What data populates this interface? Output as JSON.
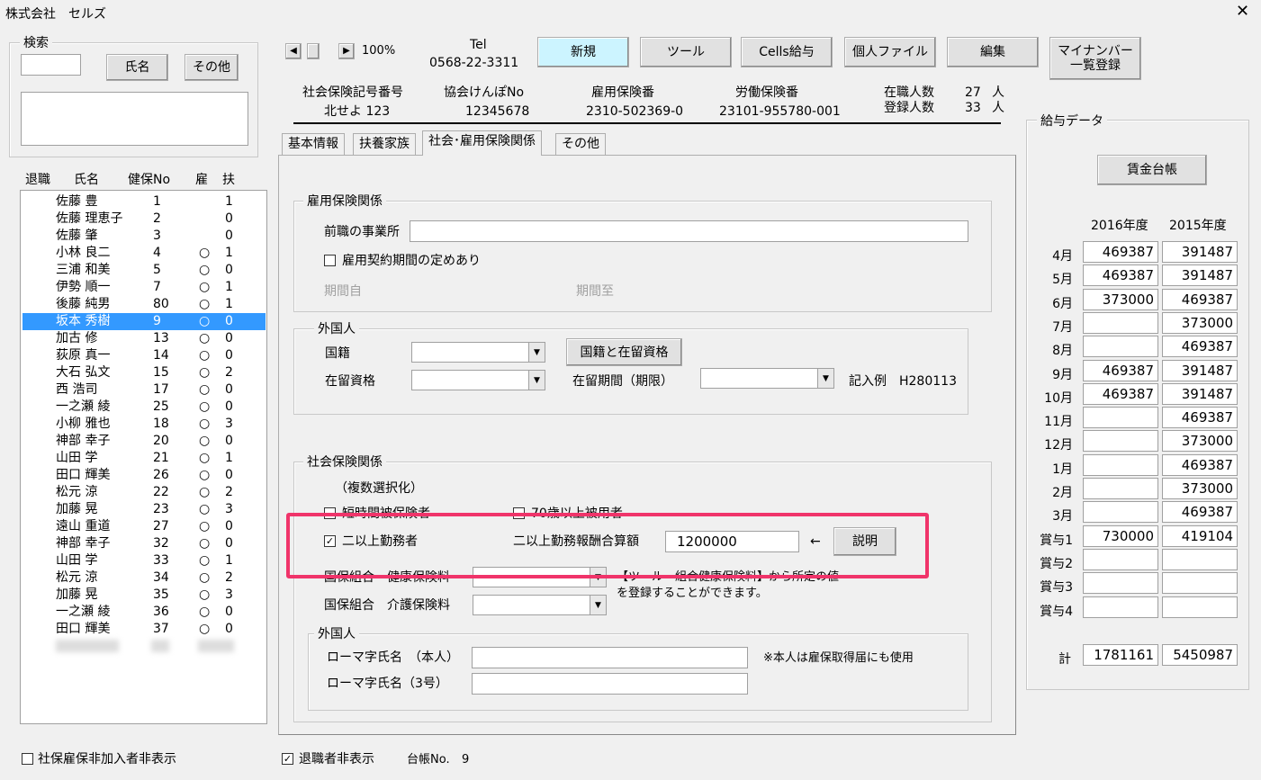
{
  "window": {
    "title": "株式会社　セルズ",
    "close_icon": "close-icon"
  },
  "search": {
    "legend": "検索",
    "name_button": "氏名",
    "other_button": "その他",
    "input_value": ""
  },
  "employee_list": {
    "headers": {
      "retired": "退職",
      "name": "氏名",
      "kenpo": "健保No",
      "koyo": "雇",
      "fuyo": "扶"
    },
    "rows": [
      {
        "name": "佐藤 豊",
        "no": "1",
        "koyo": "",
        "fuyo": "1"
      },
      {
        "name": "佐藤 理恵子",
        "no": "2",
        "koyo": "",
        "fuyo": "0"
      },
      {
        "name": "佐藤 肇",
        "no": "3",
        "koyo": "",
        "fuyo": "0"
      },
      {
        "name": "小林 良二",
        "no": "4",
        "koyo": "○",
        "fuyo": "1"
      },
      {
        "name": "三浦 和美",
        "no": "5",
        "koyo": "○",
        "fuyo": "0"
      },
      {
        "name": "伊勢 順一",
        "no": "7",
        "koyo": "○",
        "fuyo": "1"
      },
      {
        "name": "後藤 純男",
        "no": "80",
        "koyo": "○",
        "fuyo": "1"
      },
      {
        "name": "坂本 秀樹",
        "no": "9",
        "koyo": "○",
        "fuyo": "0"
      },
      {
        "name": "加古 修",
        "no": "13",
        "koyo": "○",
        "fuyo": "0"
      },
      {
        "name": "荻原 真一",
        "no": "14",
        "koyo": "○",
        "fuyo": "0"
      },
      {
        "name": "大石 弘文",
        "no": "15",
        "koyo": "○",
        "fuyo": "2"
      },
      {
        "name": "西 浩司",
        "no": "17",
        "koyo": "○",
        "fuyo": "0"
      },
      {
        "name": "一之瀬 綾",
        "no": "25",
        "koyo": "○",
        "fuyo": "0"
      },
      {
        "name": "小柳 雅也",
        "no": "18",
        "koyo": "○",
        "fuyo": "3"
      },
      {
        "name": "神部 幸子",
        "no": "20",
        "koyo": "○",
        "fuyo": "0"
      },
      {
        "name": "山田 学",
        "no": "21",
        "koyo": "○",
        "fuyo": "1"
      },
      {
        "name": "田口 輝美",
        "no": "26",
        "koyo": "○",
        "fuyo": "0"
      },
      {
        "name": "松元 涼",
        "no": "22",
        "koyo": "○",
        "fuyo": "2"
      },
      {
        "name": "加藤 晃",
        "no": "23",
        "koyo": "○",
        "fuyo": "3"
      },
      {
        "name": "遠山 重道",
        "no": "27",
        "koyo": "○",
        "fuyo": "0"
      },
      {
        "name": "神部 幸子",
        "no": "32",
        "koyo": "○",
        "fuyo": "0"
      },
      {
        "name": "山田 学",
        "no": "33",
        "koyo": "○",
        "fuyo": "1"
      },
      {
        "name": "松元 涼",
        "no": "34",
        "koyo": "○",
        "fuyo": "2"
      },
      {
        "name": "加藤 晃",
        "no": "35",
        "koyo": "○",
        "fuyo": "3"
      },
      {
        "name": "一之瀬 綾",
        "no": "36",
        "koyo": "○",
        "fuyo": "0"
      },
      {
        "name": "田口 輝美",
        "no": "37",
        "koyo": "○",
        "fuyo": "0"
      }
    ],
    "selected_index": 7
  },
  "bottom": {
    "shaho_hide_label": "社保雇保非加入者非表示",
    "shaho_hide_checked": false,
    "retired_hide_label": "退職者非表示",
    "retired_hide_checked": true,
    "ledger_label": "台帳No.",
    "ledger_no": "9"
  },
  "toolbar": {
    "zoom": "100%",
    "tel_label": "Tel",
    "tel_value": "0568-22-3311",
    "new_button": "新規",
    "tool_button": "ツール",
    "cells_button": "Cells給与",
    "personal_file_button": "個人ファイル",
    "edit_button": "編集",
    "mynumber_button_line1": "マイナンバー",
    "mynumber_button_line2": "一覧登録"
  },
  "company_info": {
    "shaho_code_label": "社会保険記号番号",
    "shaho_code_value": "北せよ 123",
    "kyokai_label": "協会けんぽNo",
    "kyokai_value": "12345678",
    "koyo_label": "雇用保険番",
    "koyo_value": "2310-502369-0",
    "rodo_label": "労働保険番",
    "rodo_value": "23101-955780-001",
    "current_count_label": "在職人数",
    "current_count": "27",
    "registered_count_label": "登録人数",
    "registered_count": "33",
    "person_unit": "人"
  },
  "tabs": [
    "基本情報",
    "扶養家族",
    "社会･雇用保険関係",
    "その他"
  ],
  "active_tab": 2,
  "employment_insurance": {
    "legend": "雇用保険関係",
    "prev_employer_label": "前職の事業所",
    "prev_employer_value": "",
    "contract_period_label": "雇用契約期間の定めあり",
    "contract_period_checked": false,
    "period_from_label": "期間自",
    "period_to_label": "期間至"
  },
  "foreigner1": {
    "legend": "外国人",
    "nationality_label": "国籍",
    "status_label": "在留資格",
    "nationality_status_button": "国籍と在留資格",
    "period_label": "在留期間（期限）",
    "example_label": "記入例　H280113"
  },
  "social_insurance": {
    "legend": "社会保険関係",
    "multi_select_note": "（複数選択化）",
    "short_time_label": "短時間被保険者",
    "over70_label": "70歳以上被用者",
    "dual_work_label": "二以上勤務者",
    "dual_work_checked": true,
    "dual_amount_label": "二以上勤務報酬合算額",
    "dual_amount_value": "1200000",
    "arrow": "←",
    "explain_button": "説明",
    "kokuho_health_label": "国保組合　健康保険料",
    "kokuho_care_label": "国保組合　介護保険料",
    "note_line1": "【ツール　組合健康保険料】から所定の値",
    "note_line2": "を登録することができます。"
  },
  "foreigner2": {
    "legend": "外国人",
    "romaji_label": "ローマ字氏名　（本人）",
    "romaji_value": "",
    "romaji_note": "※本人は雇保取得届にも使用",
    "romaji3_label": "ローマ字氏名（3号）",
    "romaji3_value": ""
  },
  "wage_data": {
    "legend": "給与データ",
    "ledger_button": "賃金台帳",
    "year1": "2016年度",
    "year2": "2015年度",
    "rows": [
      {
        "month": "4月",
        "y1": "469387",
        "y2": "391487"
      },
      {
        "month": "5月",
        "y1": "469387",
        "y2": "391487"
      },
      {
        "month": "6月",
        "y1": "373000",
        "y2": "469387"
      },
      {
        "month": "7月",
        "y1": "",
        "y2": "373000"
      },
      {
        "month": "8月",
        "y1": "",
        "y2": "469387"
      },
      {
        "month": "9月",
        "y1": "469387",
        "y2": "391487"
      },
      {
        "month": "10月",
        "y1": "469387",
        "y2": "391487"
      },
      {
        "month": "11月",
        "y1": "",
        "y2": "469387"
      },
      {
        "month": "12月",
        "y1": "",
        "y2": "373000"
      },
      {
        "month": "1月",
        "y1": "",
        "y2": "469387"
      },
      {
        "month": "2月",
        "y1": "",
        "y2": "373000"
      },
      {
        "month": "3月",
        "y1": "",
        "y2": "469387"
      },
      {
        "month": "賞与1",
        "y1": "730000",
        "y2": "419104"
      },
      {
        "month": "賞与2",
        "y1": "",
        "y2": ""
      },
      {
        "month": "賞与3",
        "y1": "",
        "y2": ""
      },
      {
        "month": "賞与4",
        "y1": "",
        "y2": ""
      }
    ],
    "total_label": "計",
    "total_y1": "1781161",
    "total_y2": "5450987"
  },
  "colors": {
    "selection": "#3399ff",
    "highlight_frame": "#f0346a",
    "new_button_bg": "#ccf4ff"
  }
}
